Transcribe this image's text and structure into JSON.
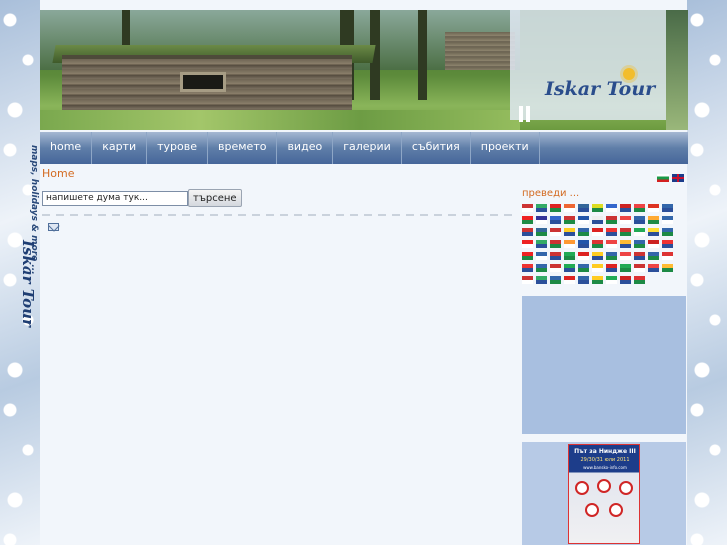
{
  "side": {
    "tagline": "maps, holidays & more ...",
    "logo": "Iskar Tour"
  },
  "header": {
    "logo": "Iskar Tour"
  },
  "nav": {
    "items": [
      "home",
      "карти",
      "турове",
      "времето",
      "видео",
      "галерии",
      "събития",
      "проекти"
    ]
  },
  "breadcrumb": "Home",
  "search": {
    "placeholder": "напишете дума тук...",
    "value": "напишете дума тук...",
    "button": "търсене"
  },
  "sidebar": {
    "translate_title": "преведи ...",
    "poster": {
      "title": "Път за Ниндже III",
      "date": "29/30/31 юли 2011",
      "site": "www.bansko-info.com"
    }
  },
  "colors": {
    "accent": "#d36b22",
    "nav": "#5f7ea8",
    "box": "#a8bfe0"
  },
  "flags": [
    "#c33",
    "#3a6",
    "#d22",
    "#e63",
    "#369",
    "#dd2",
    "#36c",
    "#c22",
    "#e44",
    "#d32",
    "#36a",
    "#e22",
    "#339",
    "#36c",
    "#c33",
    "#25a",
    "#eee",
    "#c33",
    "#e44",
    "#36a",
    "#fa3",
    "#36a",
    "#c33",
    "#369",
    "#c33",
    "#fc2",
    "#36a",
    "#d22",
    "#e33",
    "#c33",
    "#2a5",
    "#fd3",
    "#36a",
    "#e22",
    "#3a6",
    "#c33",
    "#f93",
    "#25a",
    "#d33",
    "#e44",
    "#fb3",
    "#36a",
    "#c22",
    "#e33",
    "#e22",
    "#36a",
    "#c33",
    "#2a5",
    "#d22",
    "#fc2",
    "#36a",
    "#e44",
    "#c33",
    "#36a",
    "#d33",
    "#e33",
    "#36a",
    "#c33",
    "#2a5",
    "#36a",
    "#fc2",
    "#d22",
    "#2a5",
    "#c33",
    "#e44",
    "#fb3",
    "#c33",
    "#3a6",
    "#36a",
    "#d22",
    "#36a",
    "#fc2",
    "#2a5",
    "#c22",
    "#d33"
  ]
}
